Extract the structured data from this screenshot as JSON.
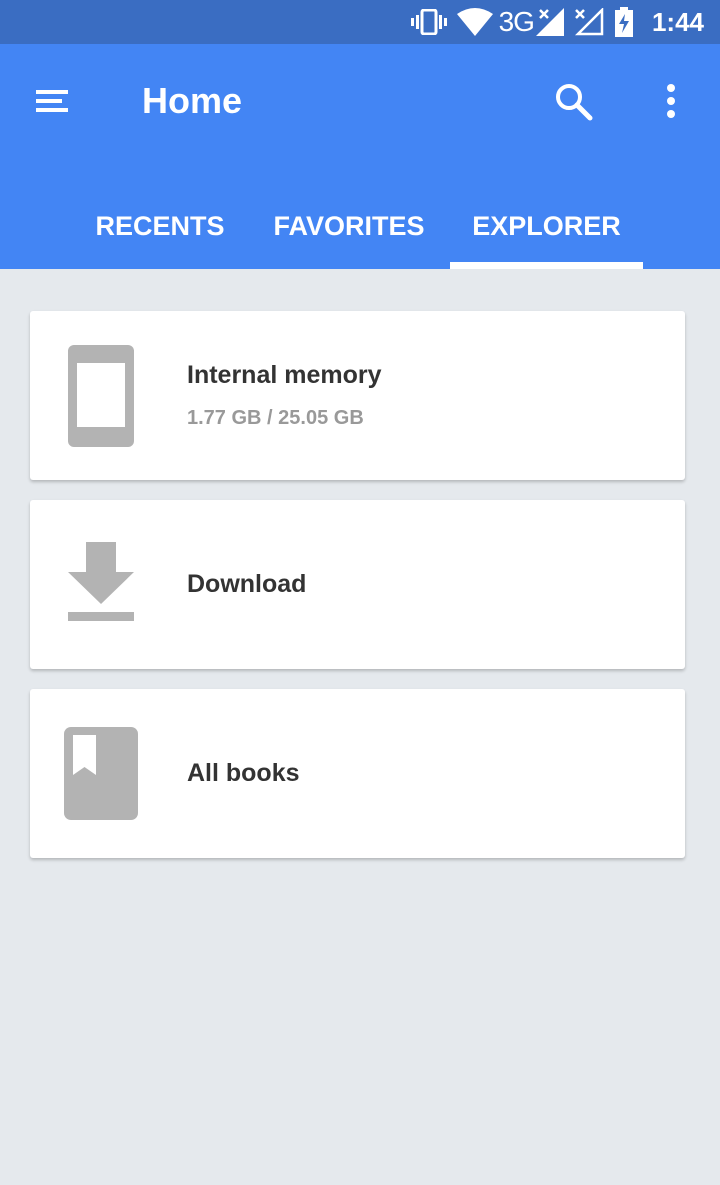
{
  "status_bar": {
    "network": "3G",
    "time": "1:44",
    "icons": [
      "vibrate-icon",
      "wifi-icon",
      "signal-icon",
      "signal-no-service-icon",
      "battery-charging-icon"
    ]
  },
  "app_bar": {
    "title": "Home",
    "icons": [
      "hamburger-menu-icon",
      "search-icon",
      "more-vert-icon"
    ]
  },
  "tabs": [
    {
      "label": "RECENTS",
      "selected": false
    },
    {
      "label": "FAVORITES",
      "selected": false
    },
    {
      "label": "EXPLORER",
      "selected": true
    }
  ],
  "cards": [
    {
      "title": "Internal memory",
      "subtitle": "1.77 GB / 25.05 GB",
      "icon": "phone-icon"
    },
    {
      "title": "Download",
      "icon": "download-icon"
    },
    {
      "title": "All books",
      "icon": "book-icon"
    }
  ],
  "colors": {
    "primary": "#4385f4",
    "status_bar": "#3a6dc2",
    "background": "#e5e9ed",
    "icon_gray": "#b3b3b3"
  }
}
